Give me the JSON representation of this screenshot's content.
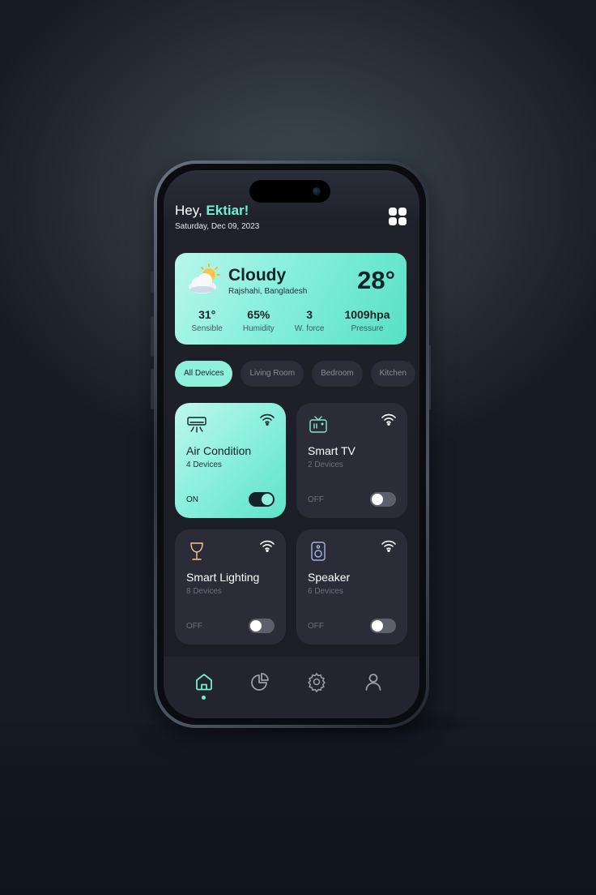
{
  "greeting": {
    "prefix": "Hey, ",
    "name": "Ektiar!",
    "date": "Saturday, Dec 09, 2023"
  },
  "header": {
    "menu_icon": "grid-icon"
  },
  "weather": {
    "icon": "partly-cloudy-icon",
    "condition": "Cloudy",
    "location": "Rajshahi, Bangladesh",
    "temperature": "28°",
    "stats": [
      {
        "value": "31°",
        "label": "Sensible"
      },
      {
        "value": "65%",
        "label": "Humidity"
      },
      {
        "value": "3",
        "label": "W. force"
      },
      {
        "value": "1009hpa",
        "label": "Pressure"
      }
    ]
  },
  "filters": [
    "All Devices",
    "Living Room",
    "Bedroom",
    "Kitchen"
  ],
  "active_filter": "All Devices",
  "devices": [
    {
      "name": "Air Condition",
      "count": "4 Devices",
      "state": "ON",
      "on": true,
      "icon": "air-conditioner-icon"
    },
    {
      "name": "Smart TV",
      "count": "2 Devices",
      "state": "OFF",
      "on": false,
      "icon": "tv-icon"
    },
    {
      "name": "Smart Lighting",
      "count": "8 Devices",
      "state": "OFF",
      "on": false,
      "icon": "lamp-icon"
    },
    {
      "name": "Speaker",
      "count": "6 Devices",
      "state": "OFF",
      "on": false,
      "icon": "speaker-icon"
    }
  ],
  "tabbar": {
    "items": [
      "home-icon",
      "stats-icon",
      "settings-icon",
      "profile-icon"
    ],
    "active": "home-icon"
  },
  "colors": {
    "accent": "#6ff0d6",
    "card_dark": "#2c2b38",
    "background": "#1b1c24"
  }
}
